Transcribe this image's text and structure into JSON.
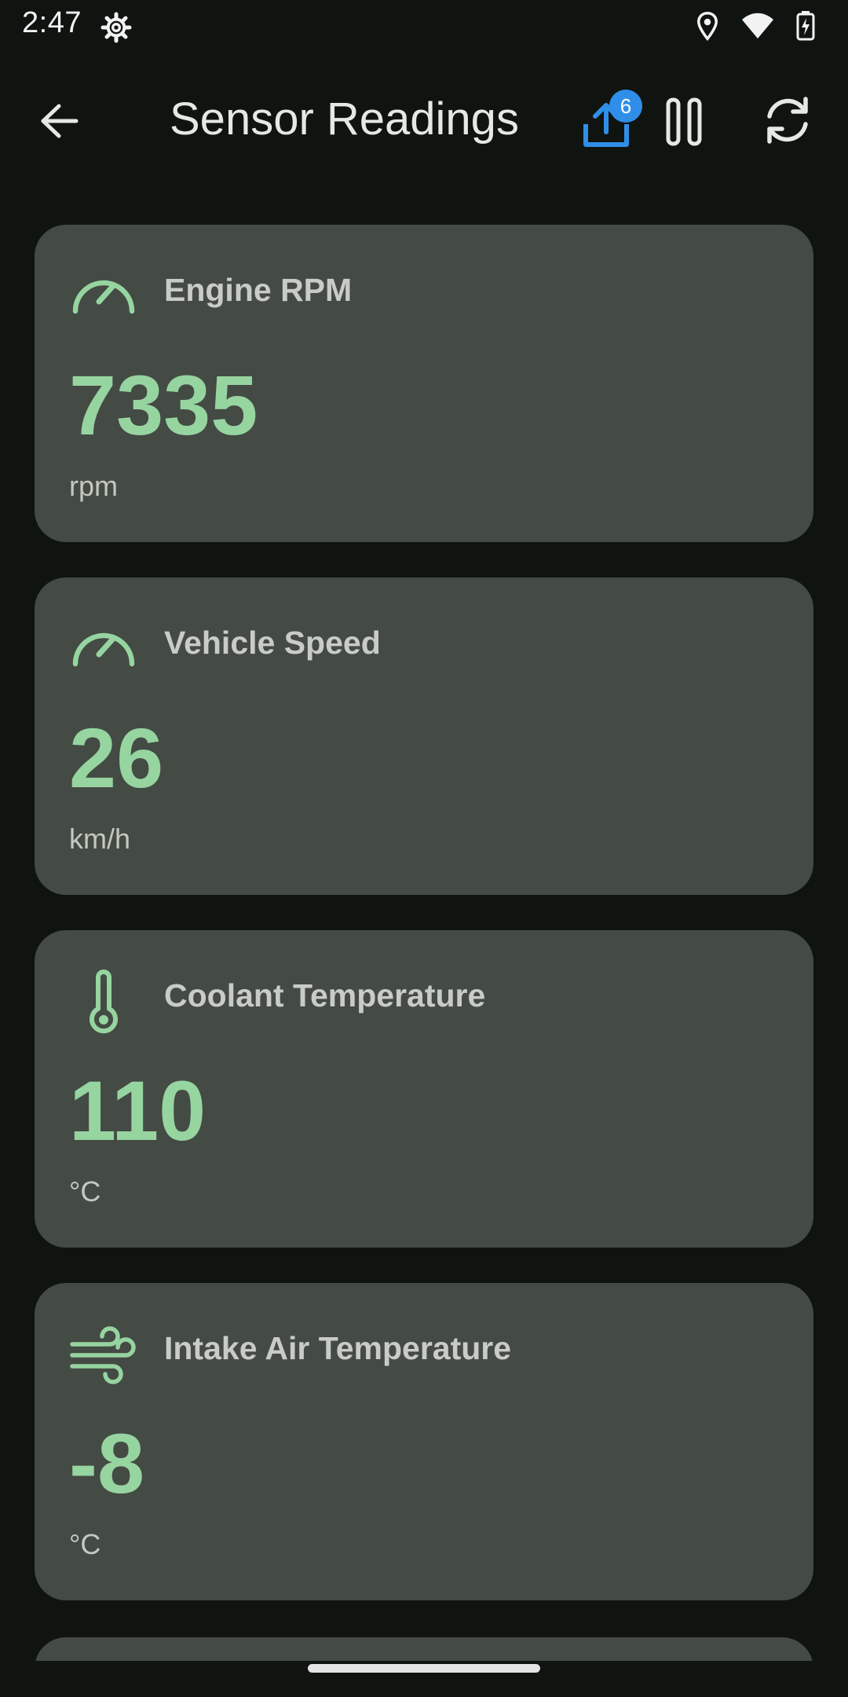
{
  "status_bar": {
    "time": "2:47",
    "icons": [
      "settings-icon",
      "location-icon",
      "wifi-icon",
      "battery-charging-icon"
    ]
  },
  "app_bar": {
    "title": "Sensor Readings",
    "upload_badge_count": "6",
    "actions": [
      "back-arrow-icon",
      "upload-icon",
      "pause-icon",
      "refresh-icon"
    ]
  },
  "sensors": [
    {
      "title": "Engine RPM",
      "value": "7335",
      "unit": "rpm",
      "icon": "speedometer-icon"
    },
    {
      "title": "Vehicle Speed",
      "value": "26",
      "unit": "km/h",
      "icon": "speedometer-icon"
    },
    {
      "title": "Coolant Temperature",
      "value": "110",
      "unit": "°C",
      "icon": "thermometer-icon"
    },
    {
      "title": "Intake Air Temperature",
      "value": "-8",
      "unit": "°C",
      "icon": "wind-icon"
    }
  ],
  "colors": {
    "background": "#101411",
    "card": "#444a44",
    "accent_green": "#96d4a0",
    "badge_blue": "#2f8fe8"
  }
}
